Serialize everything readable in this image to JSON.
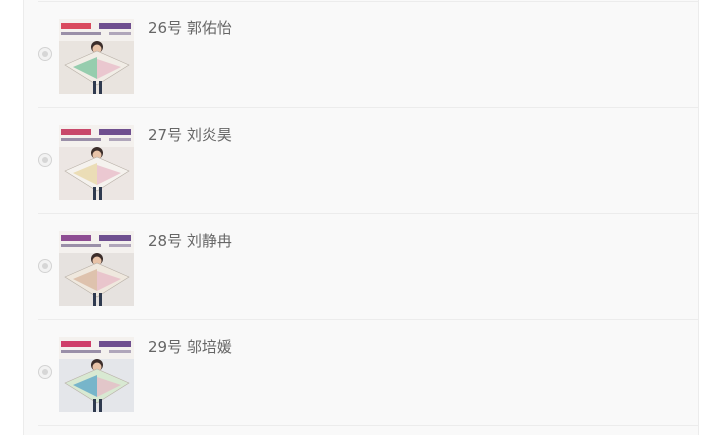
{
  "entries": [
    {
      "label": "26号 郭佑怡",
      "palette": {
        "bg": "#e9e4df",
        "banner": "#d94a5e",
        "kite": "#f1ede6",
        "wing": "#7fc4a0"
      }
    },
    {
      "label": "27号 刘炎昊",
      "palette": {
        "bg": "#ece6e3",
        "banner": "#c8486b",
        "kite": "#f5f2ee",
        "wing": "#e8d7a8"
      }
    },
    {
      "label": "28号 刘静冉",
      "palette": {
        "bg": "#e6e2df",
        "banner": "#8e4d92",
        "kite": "#efe8de",
        "wing": "#d9b8a0"
      }
    },
    {
      "label": "29号 邬培媛",
      "palette": {
        "bg": "#e4e6ea",
        "banner": "#cf3f6a",
        "kite": "#d8e9d2",
        "wing": "#5fa8c8"
      }
    }
  ]
}
